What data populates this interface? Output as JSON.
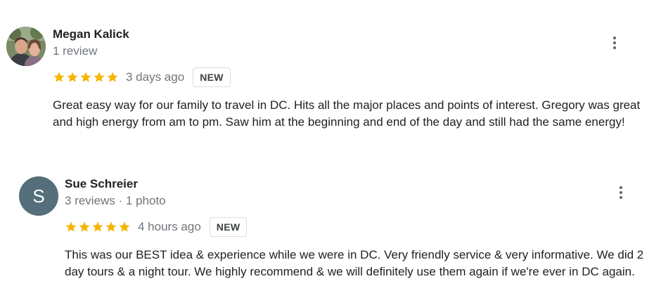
{
  "reviews": [
    {
      "name": "Megan Kalick",
      "meta": "1 review",
      "rating": 5,
      "time": "3 days ago",
      "badge": "NEW",
      "text": "Great easy way for our family to travel in DC. Hits all the major places and points of interest. Gregory was great and high energy from am to pm. Saw him at the beginning and end of the day and still had the same energy!"
    },
    {
      "name": "Sue Schreier",
      "avatar_letter": "S",
      "meta": "3 reviews · 1 photo",
      "rating": 5,
      "time": "4 hours ago",
      "badge": "NEW",
      "text": "This was our BEST idea & experience while we were in DC. Very friendly service & very informative. We did 2 day tours & a night tour. We highly recommend & we will definitely use them again if we're ever in DC again."
    }
  ],
  "colors": {
    "star": "#f4b400",
    "avatar_letter_bg": "#546e7a"
  },
  "icons": {
    "rating": "star-icon",
    "menu": "more-vert-icon"
  }
}
